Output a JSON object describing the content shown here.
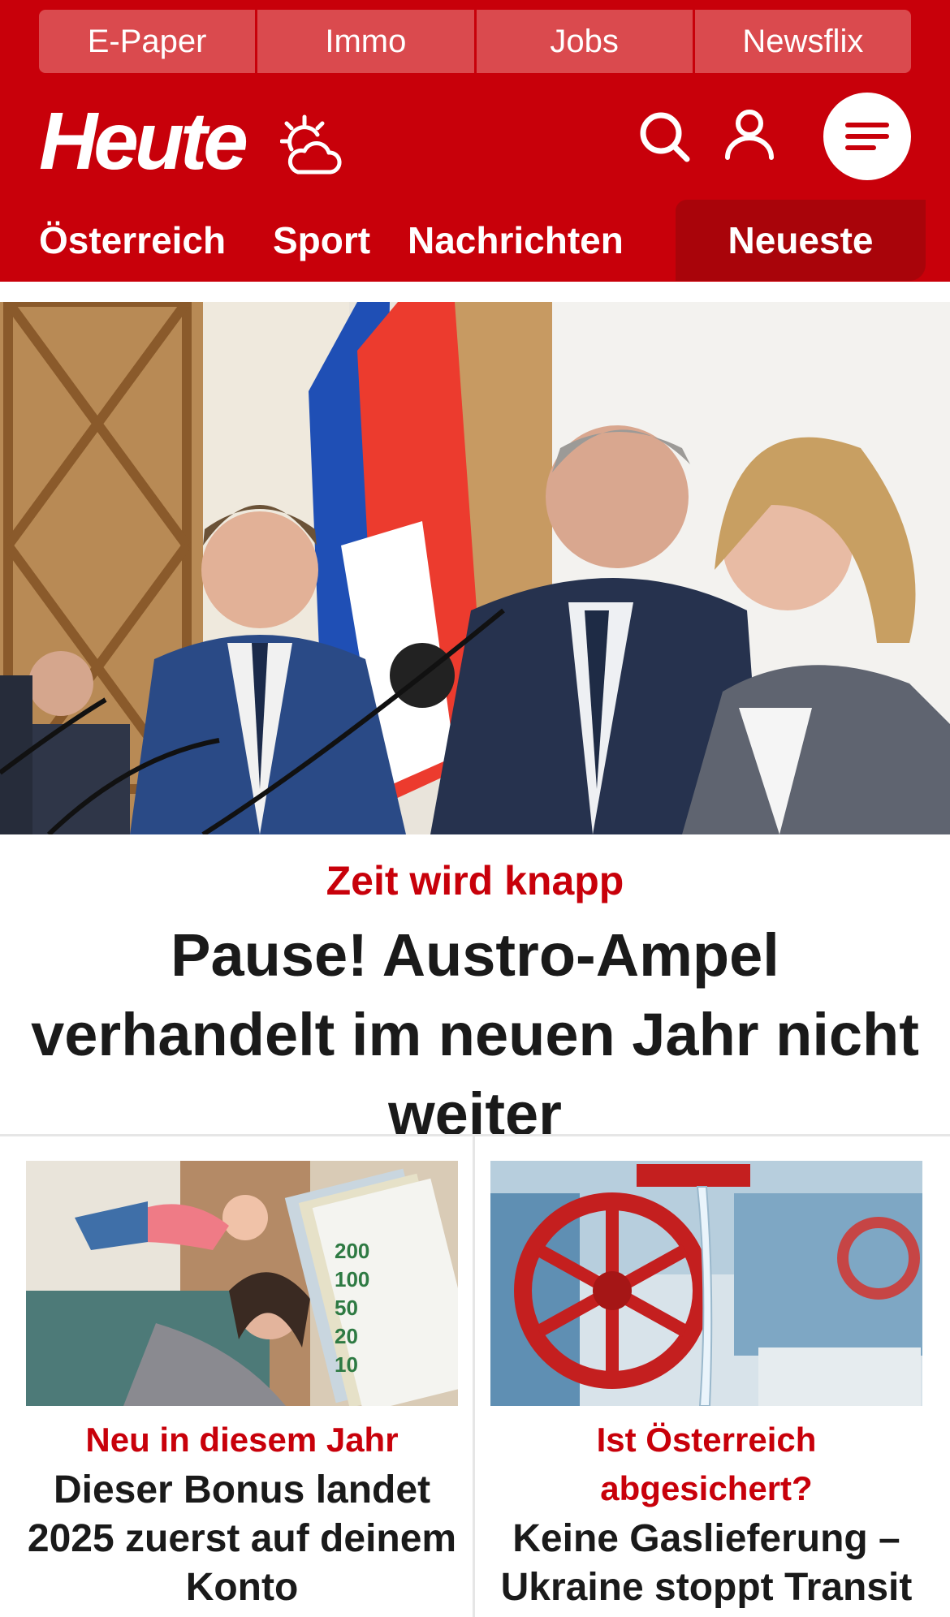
{
  "quicklinks": [
    "E-Paper",
    "Immo",
    "Jobs",
    "Newsflix"
  ],
  "brand": {
    "logo_text": "Heute",
    "primary_color": "#c8000a",
    "dark_red": "#a9040a",
    "weather_icon": "partly-cloudy-sun-icon"
  },
  "header_icons": {
    "search": "search-icon",
    "account": "user-icon",
    "menu": "hamburger-menu-icon"
  },
  "nav": {
    "items": [
      "Österreich",
      "Sport",
      "Nachrichten"
    ],
    "highlight": "Neueste"
  },
  "hero": {
    "kicker": "Zeit wird knapp",
    "title": "Pause! Austro-Ampel verhandelt im neuen Jahr nicht weiter"
  },
  "teasers": [
    {
      "kicker": "Neu in diesem Jahr",
      "title": "Dieser Bonus landet 2025 zuerst auf deinem Konto"
    },
    {
      "kicker": "Ist Österreich abgesichert?",
      "title": "Keine Gaslieferung – Ukraine stoppt Transit"
    }
  ]
}
